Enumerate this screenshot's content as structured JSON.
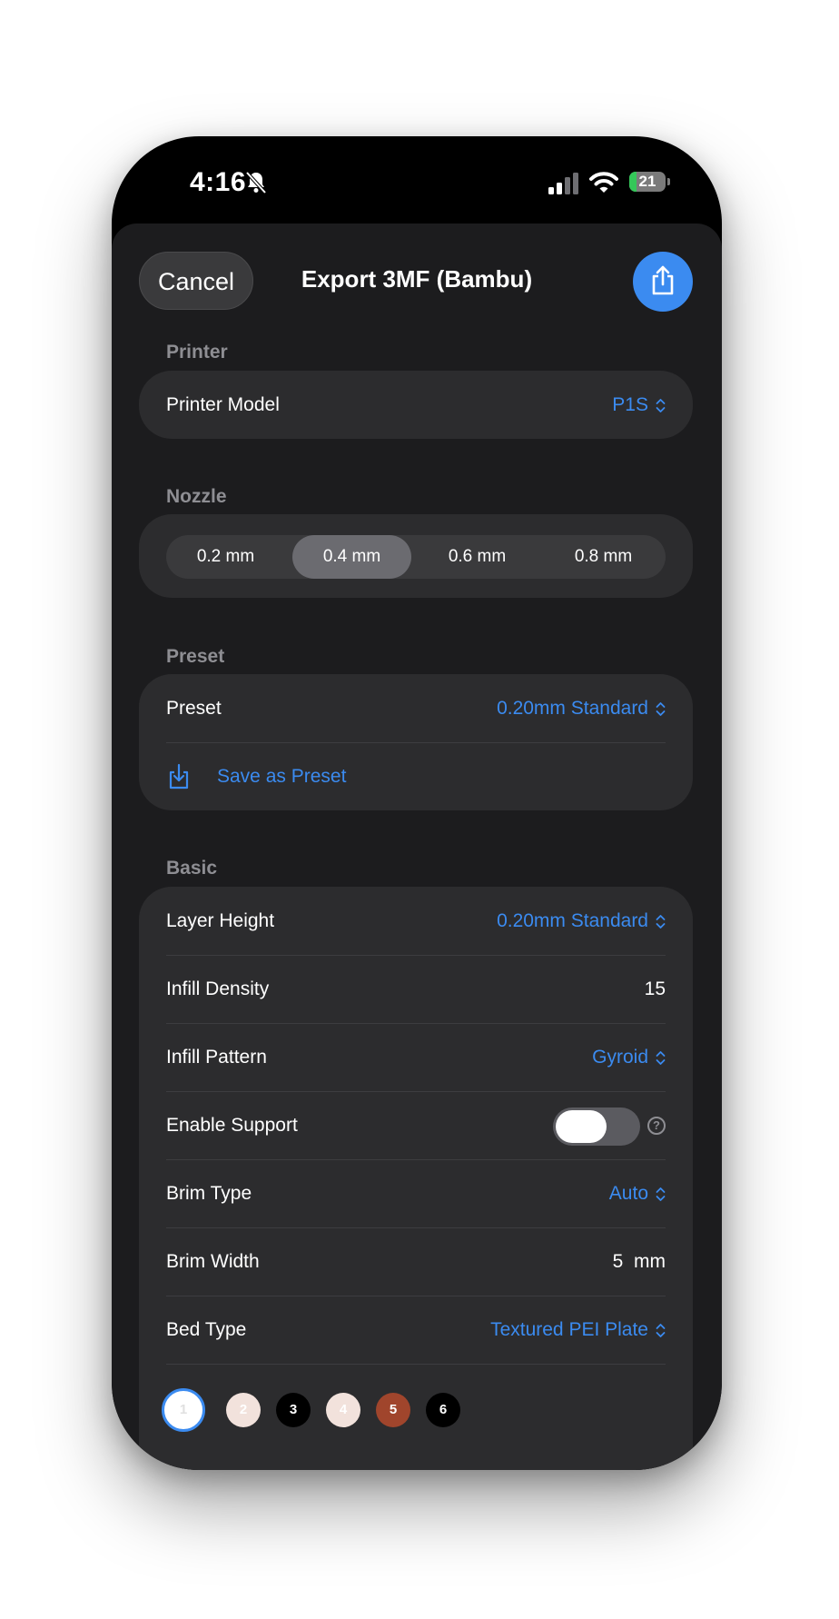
{
  "status_bar": {
    "time": "4:16",
    "battery": "21",
    "battery_fraction": 0.21
  },
  "header": {
    "cancel_label": "Cancel",
    "title": "Export 3MF (Bambu)",
    "share_icon": "share-icon"
  },
  "printer": {
    "section_label": "Printer",
    "model_label": "Printer Model",
    "model_value": "P1S"
  },
  "nozzle": {
    "section_label": "Nozzle",
    "options": [
      "0.2 mm",
      "0.4 mm",
      "0.6 mm",
      "0.8 mm"
    ],
    "selected": "0.4 mm"
  },
  "preset": {
    "section_label": "Preset",
    "label": "Preset",
    "value": "0.20mm Standard",
    "save_label": "Save as Preset"
  },
  "basic": {
    "section_label": "Basic",
    "layer_height_label": "Layer Height",
    "layer_height_value": "0.20mm Standard",
    "infill_density_label": "Infill Density",
    "infill_density_value": "15",
    "infill_pattern_label": "Infill Pattern",
    "infill_pattern_value": "Gyroid",
    "enable_support_label": "Enable Support",
    "enable_support_on": false,
    "help_glyph": "?",
    "brim_type_label": "Brim Type",
    "brim_type_value": "Auto",
    "brim_width_label": "Brim Width",
    "brim_width_value": "5  mm",
    "bed_type_label": "Bed Type",
    "bed_type_value": "Textured PEI Plate"
  },
  "filament_swatches": [
    {
      "label": "1",
      "color": "#ffffff",
      "text_color": "#e0e0e0",
      "selected": true
    },
    {
      "label": "2",
      "color": "#f2e2dc",
      "text_color": "#ffffff",
      "selected": false
    },
    {
      "label": "3",
      "color": "#000000",
      "text_color": "#ffffff",
      "selected": false
    },
    {
      "label": "4",
      "color": "#f2e2dc",
      "text_color": "#ffffff",
      "selected": false
    },
    {
      "label": "5",
      "color": "#a0452c",
      "text_color": "#ffffff",
      "selected": false
    },
    {
      "label": "6",
      "color": "#000000",
      "text_color": "#ffffff",
      "selected": false
    }
  ],
  "colors": {
    "accent": "#3b8bf0",
    "sheet_bg": "#1c1c1e",
    "card_bg": "#2c2c2e"
  }
}
